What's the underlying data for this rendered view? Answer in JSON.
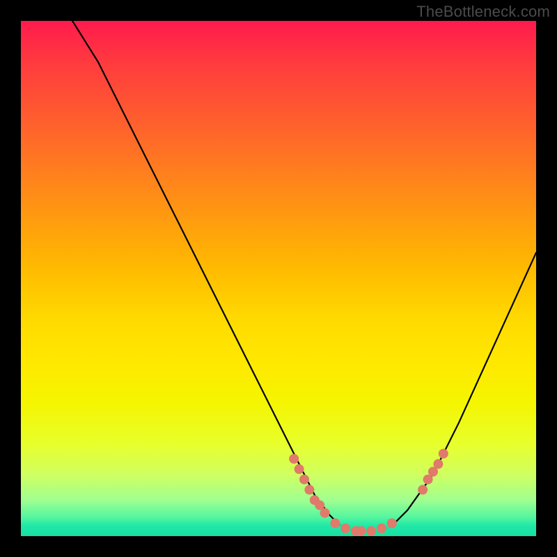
{
  "watermark": "TheBottleneck.com",
  "chart_data": {
    "type": "line",
    "title": "",
    "xlabel": "",
    "ylabel": "",
    "xlim": [
      0,
      100
    ],
    "ylim": [
      0,
      100
    ],
    "grid": false,
    "legend": false,
    "series": [
      {
        "name": "bottleneck-curve",
        "x": [
          10,
          15,
          20,
          25,
          30,
          35,
          40,
          45,
          50,
          55,
          57,
          60,
          62,
          65,
          68,
          70,
          72,
          75,
          80,
          85,
          90,
          95,
          100
        ],
        "values": [
          100,
          92,
          82,
          72,
          62,
          52,
          42,
          32,
          22,
          12,
          8,
          4,
          2,
          1,
          1,
          1,
          2,
          5,
          12,
          22,
          33,
          44,
          55
        ]
      }
    ],
    "markers": [
      {
        "x": 53,
        "y": 15
      },
      {
        "x": 54,
        "y": 13
      },
      {
        "x": 55,
        "y": 11
      },
      {
        "x": 56,
        "y": 9
      },
      {
        "x": 57,
        "y": 7
      },
      {
        "x": 58,
        "y": 6
      },
      {
        "x": 59,
        "y": 4.5
      },
      {
        "x": 61,
        "y": 2.5
      },
      {
        "x": 63,
        "y": 1.5
      },
      {
        "x": 65,
        "y": 1
      },
      {
        "x": 66,
        "y": 1
      },
      {
        "x": 68,
        "y": 1
      },
      {
        "x": 70,
        "y": 1.5
      },
      {
        "x": 72,
        "y": 2.5
      },
      {
        "x": 78,
        "y": 9
      },
      {
        "x": 79,
        "y": 11
      },
      {
        "x": 80,
        "y": 12.5
      },
      {
        "x": 81,
        "y": 14
      },
      {
        "x": 82,
        "y": 16
      }
    ],
    "background_gradient": {
      "top": "#ff1a4d",
      "mid1": "#ff9a10",
      "mid2": "#ffe800",
      "bottom": "#18e0a0"
    }
  }
}
